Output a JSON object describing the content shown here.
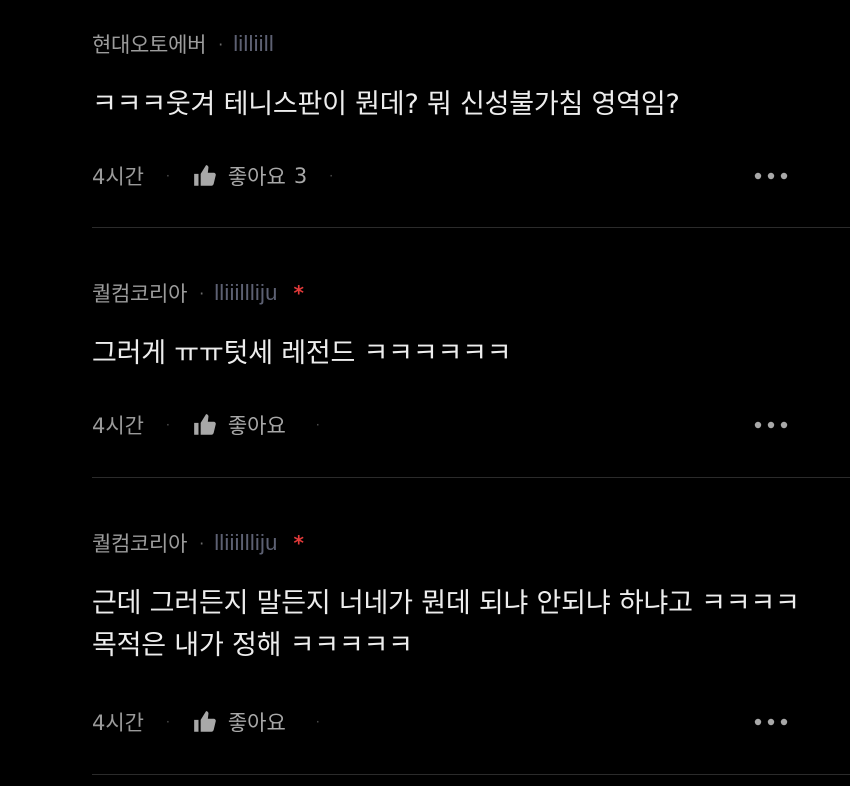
{
  "comments": [
    {
      "author": "현대오토에버",
      "separator": "·",
      "user_id": "lilliill",
      "badge": "",
      "text": "ㅋㅋㅋ웃겨 테니스판이 뭔데? 뭐 신성불가침 영역임?",
      "time": "4시간",
      "action_separator": "·",
      "like_label": "좋아요",
      "like_count": "3"
    },
    {
      "author": "퀄컴코리아",
      "separator": "·",
      "user_id": "lliiillliju",
      "badge": "*",
      "text": "그러게 ㅠㅠ텃세 레전드 ㅋㅋㅋㅋㅋㅋ",
      "time": "4시간",
      "action_separator": "·",
      "like_label": "좋아요",
      "like_count": ""
    },
    {
      "author": "퀄컴코리아",
      "separator": "·",
      "user_id": "lliiillliju",
      "badge": "*",
      "text": "근데 그러든지 말든지 너네가 뭔데 되냐 안되냐 하냐고 ㅋㅋㅋㅋ 목적은 내가 정해 ㅋㅋㅋㅋㅋ",
      "time": "4시간",
      "action_separator": "·",
      "like_label": "좋아요",
      "like_count": ""
    }
  ],
  "icons": {
    "like": "thumbs-up-icon",
    "more": "more-horizontal-icon"
  },
  "colors": {
    "background": "#000000",
    "badge": "#e23a3a",
    "user_id": "#5d6173"
  }
}
